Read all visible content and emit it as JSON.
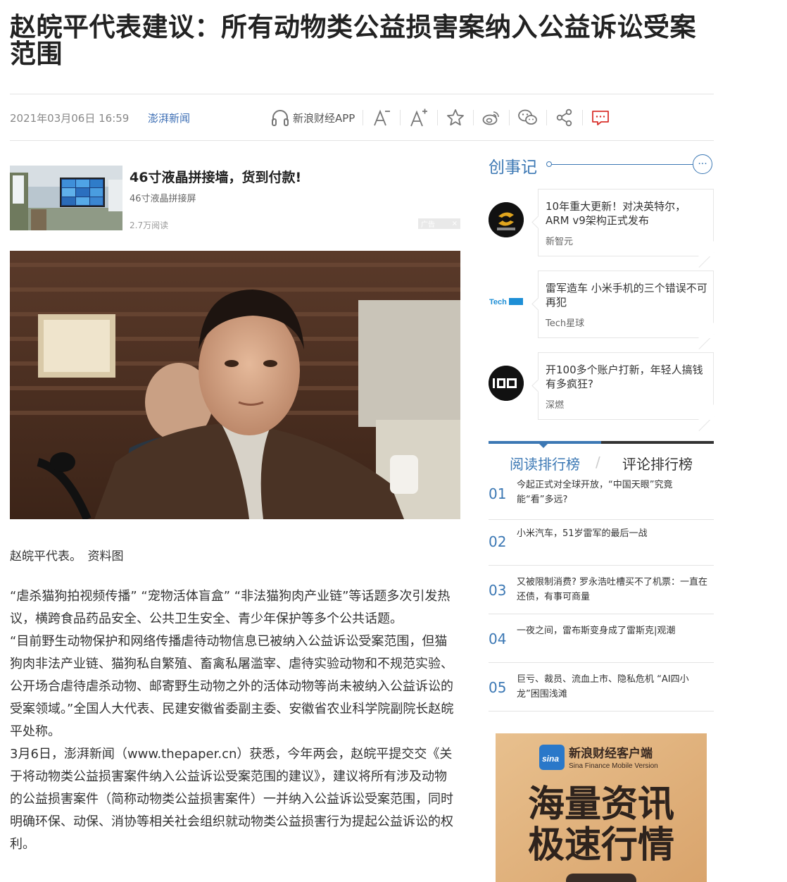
{
  "article": {
    "title": "赵皖平代表建议：所有动物类公益损害案纳入公益诉讼受案范围",
    "date": "2021年03月06日 16:59",
    "source": "澎湃新闻",
    "caption": "赵皖平代表。　资料图",
    "paragraphs": [
      "“虐杀猫狗拍视频传播” “宠物活体盲盒” “非法猫狗肉产业链”等话题多次引发热议，横跨食品药品安全、公共卫生安全、青少年保护等多个公共话题。",
      "“目前野生动物保护和网络传播虐待动物信息已被纳入公益诉讼受案范围，但猫狗肉非法产业链、猫狗私自繁殖、畜禽私屠滥宰、虐待实验动物和不规范实验、公开场合虐待虐杀动物、邮寄野生动物之外的活体动物等尚未被纳入公益诉讼的受案领域。”全国人大代表、民建安徽省委副主委、安徽省农业科学院副院长赵皖平处称。",
      "3月6日，澎湃新闻（www.thepaper.cn）获悉，今年两会，赵皖平提交交《关于将动物类公益损害案件纳入公益诉讼受案范围的建议》，建议将所有涉及动物的公益损害案件（简称动物类公益损害案件）一并纳入公益诉讼受案范围，同时明确环保、动保、消协等相关社会组织就动物类公益损害行为提起公益诉讼的权利。"
    ]
  },
  "toolbar": {
    "app_label": "新浪财经APP",
    "icons": [
      "headphone-icon",
      "font-decrease-icon",
      "font-increase-icon",
      "star-icon",
      "weibo-icon",
      "wechat-icon",
      "share-icon",
      "comment-icon"
    ]
  },
  "ad": {
    "title": "46寸液晶拼接墙，货到付款!",
    "subtitle": "46寸液晶拼接屏",
    "reads": "2.7万阅读",
    "badge": "广告"
  },
  "sidebar": {
    "chuangshi_title": "创事记",
    "chuangshi_items": [
      {
        "text": "10年重大更新！对决英特尔，ARM v9架构正式发布",
        "source": "新智元",
        "avatar_label": "新智元"
      },
      {
        "text": "雷军造车 小米手机的三个错误不可再犯",
        "source": "Tech星球",
        "avatar_label": "Tech星球"
      },
      {
        "text": "开100多个账户打新，年轻人搞钱有多疯狂?",
        "source": "深燃",
        "avatar_label": "深燃"
      }
    ],
    "rank_tabs": [
      "阅读排行榜",
      "评论排行榜"
    ],
    "rank_items": [
      {
        "num": "01",
        "text": "今起正式对全球开放，“中国天眼”究竟能“看”多远?"
      },
      {
        "num": "02",
        "text": "小米汽车，51岁雷军的最后一战"
      },
      {
        "num": "03",
        "text": "又被限制消费? 罗永浩吐槽买不了机票：一直在还债，有事可商量"
      },
      {
        "num": "04",
        "text": "一夜之间，雷布斯变身成了雷斯克|观潮"
      },
      {
        "num": "05",
        "text": "巨亏、裁员、流血上市、隐私危机 “AI四小龙”困围浅滩"
      }
    ]
  },
  "promo": {
    "brand": "新浪财经客户端",
    "brand_en": "Sina Finance Mobile Version",
    "slogan_1": "海量资讯",
    "slogan_2": "极速行情",
    "logo_text": "sina"
  }
}
